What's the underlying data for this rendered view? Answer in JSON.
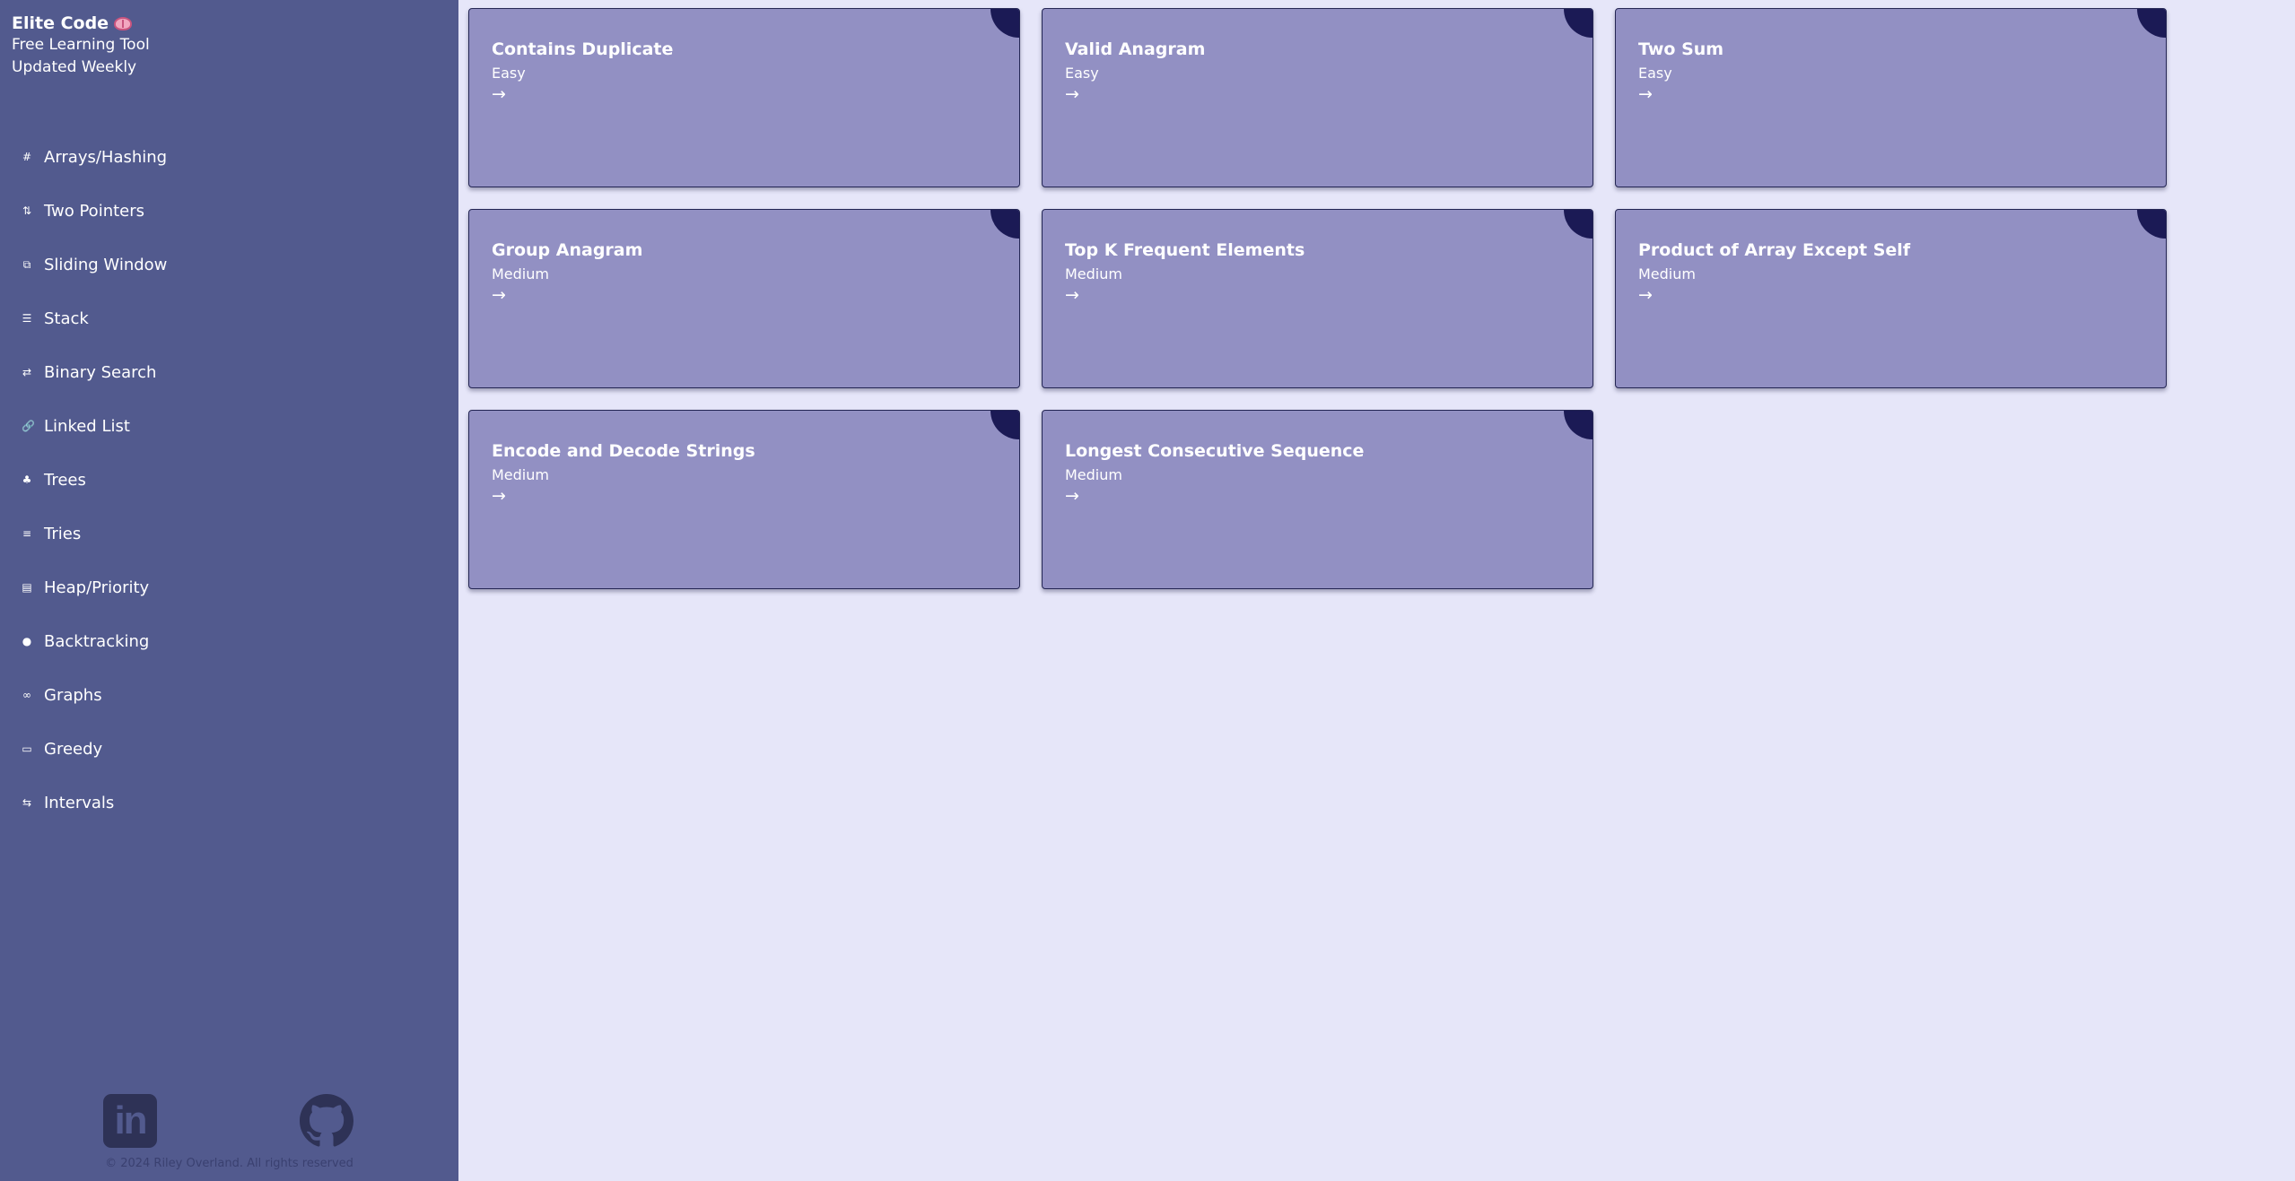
{
  "brand": {
    "title": "Elite Code",
    "lines": [
      "Free Learning Tool",
      "Updated Weekly"
    ]
  },
  "nav": [
    {
      "icon": "#",
      "icon_name": "hash-icon",
      "label": "Arrays/Hashing"
    },
    {
      "icon": "⇅",
      "icon_name": "two-arrows-icon",
      "label": "Two Pointers"
    },
    {
      "icon": "⧉",
      "icon_name": "window-icon",
      "label": "Sliding Window"
    },
    {
      "icon": "☰",
      "icon_name": "stack-icon",
      "label": "Stack"
    },
    {
      "icon": "⇄",
      "icon_name": "exchange-icon",
      "label": "Binary Search"
    },
    {
      "icon": "🔗",
      "icon_name": "link-icon",
      "label": "Linked List"
    },
    {
      "icon": "♣",
      "icon_name": "tree-icon",
      "label": "Trees"
    },
    {
      "icon": "≡",
      "icon_name": "list-icon",
      "label": "Tries"
    },
    {
      "icon": "▤",
      "icon_name": "layers-icon",
      "label": "Heap/Priority"
    },
    {
      "icon": "●",
      "icon_name": "circle-icon",
      "label": "Backtracking"
    },
    {
      "icon": "∞",
      "icon_name": "infinity-icon",
      "label": "Graphs"
    },
    {
      "icon": "▭",
      "icon_name": "card-icon",
      "label": "Greedy"
    },
    {
      "icon": "⇆",
      "icon_name": "interval-icon",
      "label": "Intervals"
    }
  ],
  "footer": {
    "linkedin_text": "in",
    "copyright": "© 2024 Riley Overland. All rights reserved"
  },
  "cards": [
    {
      "title": "Contains Duplicate",
      "difficulty": "Easy",
      "arrow": "→"
    },
    {
      "title": "Valid Anagram",
      "difficulty": "Easy",
      "arrow": "→"
    },
    {
      "title": "Two Sum",
      "difficulty": "Easy",
      "arrow": "→"
    },
    {
      "title": "Group Anagram",
      "difficulty": "Medium",
      "arrow": "→"
    },
    {
      "title": "Top K Frequent Elements",
      "difficulty": "Medium",
      "arrow": "→"
    },
    {
      "title": "Product of Array Except Self",
      "difficulty": "Medium",
      "arrow": "→"
    },
    {
      "title": "Encode and Decode Strings",
      "difficulty": "Medium",
      "arrow": "→"
    },
    {
      "title": "Longest Consecutive Sequence",
      "difficulty": "Medium",
      "arrow": "→"
    }
  ],
  "colors": {
    "sidebar": "#525a8e",
    "background": "#e6e6f9",
    "card": "#9290c3",
    "accent": "#1b1a55"
  }
}
